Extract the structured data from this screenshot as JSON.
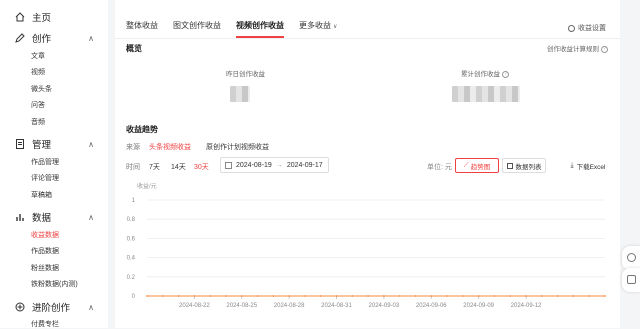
{
  "sidebar": {
    "home": "主页",
    "create": {
      "label": "创作",
      "items": [
        "文章",
        "视频",
        "微头条",
        "问答",
        "音频"
      ]
    },
    "manage": {
      "label": "管理",
      "items": [
        "作品管理",
        "评论管理",
        "草稿箱"
      ]
    },
    "data": {
      "label": "数据",
      "items": [
        "收益数据",
        "作品数据",
        "粉丝数据",
        "铁粉数据(内测)"
      ],
      "active_index": 0
    },
    "advanced": {
      "label": "进阶创作",
      "items": [
        "付费专栏"
      ]
    }
  },
  "tabs": [
    "整体收益",
    "图文创作收益",
    "视频创作收益",
    "更多收益"
  ],
  "active_tab": 2,
  "settings_label": "收益设置",
  "overview": {
    "title": "概览",
    "rule_link": "创作收益计算规则",
    "yesterday_label": "昨日创作收益",
    "total_label": "累计创作收益"
  },
  "trend": {
    "title": "收益趋势",
    "source_label": "来源",
    "sources": [
      "头条视频收益",
      "原创作计划视频收益"
    ],
    "time_label": "时间",
    "ranges": [
      "7天",
      "14天",
      "30天"
    ],
    "active_range": 2,
    "date_start": "2024-08-19",
    "date_sep": "→",
    "date_end": "2024-09-17",
    "unit": "单位: 元",
    "chart_btn": "趋势图",
    "table_btn": "数据列表",
    "download": "下载Excel"
  },
  "chart_data": {
    "type": "line",
    "ylabel": "收益/元",
    "ylim": [
      0,
      1
    ],
    "yticks": [
      "1",
      "0.8",
      "0.6",
      "0.4",
      "0.2",
      "0"
    ],
    "xticks": [
      "2024-08-22",
      "2024-08-25",
      "2024-08-28",
      "2024-08-31",
      "2024-09-03",
      "2024-09-06",
      "2024-09-09",
      "2024-09-12"
    ],
    "series": [
      {
        "values": [
          0,
          0,
          0,
          0,
          0,
          0,
          0,
          0,
          0,
          0,
          0,
          0,
          0,
          0,
          0,
          0,
          0,
          0,
          0,
          0,
          0,
          0,
          0,
          0,
          0,
          0,
          0,
          0,
          0,
          0
        ]
      }
    ],
    "line_color": "#f5893d"
  }
}
